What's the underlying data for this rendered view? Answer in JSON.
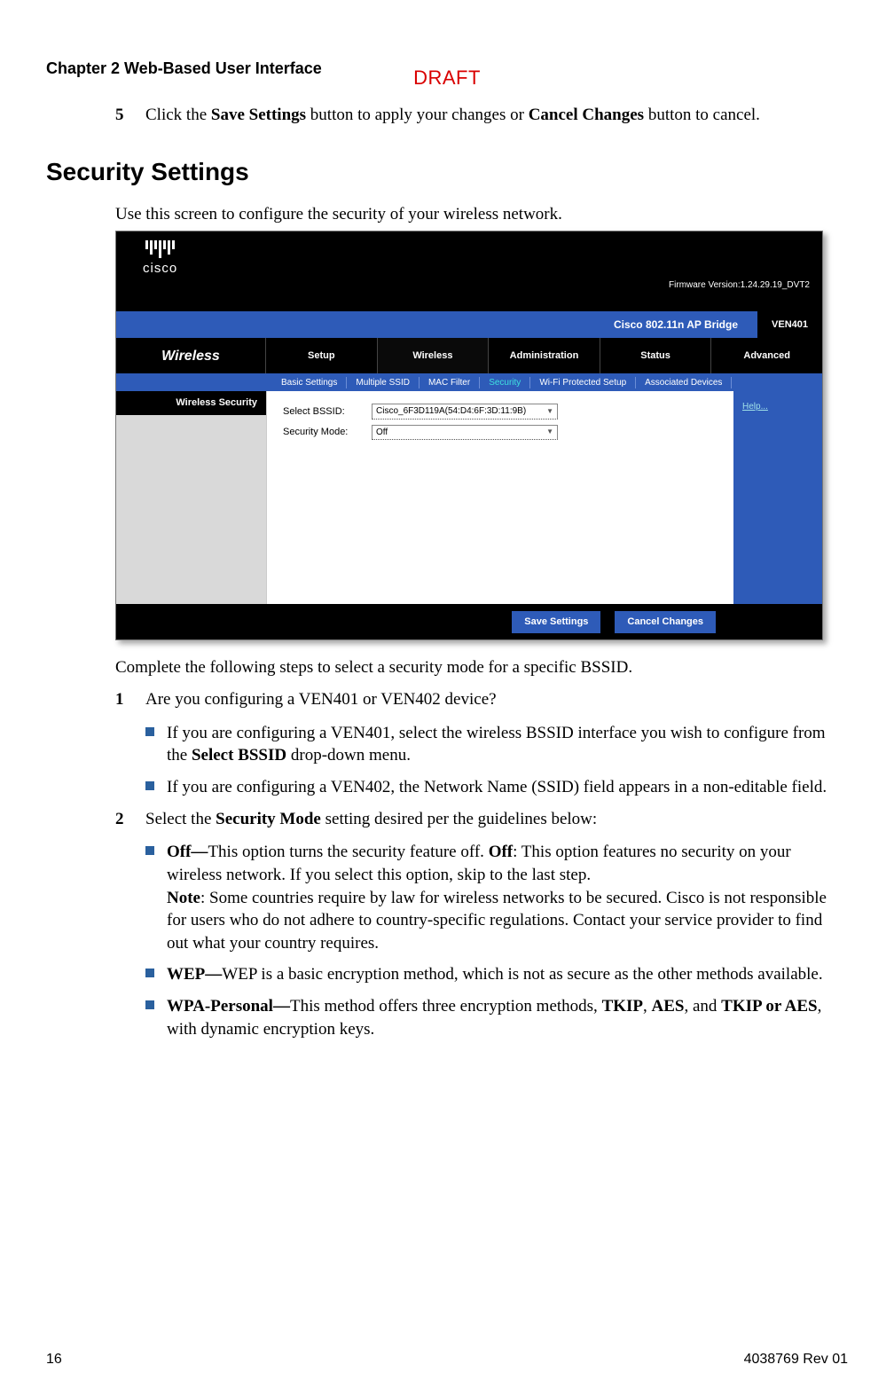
{
  "draft": "DRAFT",
  "chapter": "Chapter 2    Web-Based User Interface",
  "step5_num": "5",
  "step5_a": "Click the ",
  "step5_b": "Save Settings",
  "step5_c": " button to apply your changes or ",
  "step5_d": "Cancel Changes",
  "step5_e": " button to cancel.",
  "section": "Security Settings",
  "intro": "Use this screen to configure the security of your wireless network.",
  "shot": {
    "cisco": "cisco",
    "fw": "Firmware Version:1.24.29.19_DVT2",
    "product": "Cisco 802.11n AP Bridge",
    "model": "VEN401",
    "wireless": "Wireless",
    "tabs": [
      "Setup",
      "Wireless",
      "Administration",
      "Status",
      "Advanced"
    ],
    "subnav": [
      "Basic Settings",
      "Multiple SSID",
      "MAC Filter",
      "Security",
      "Wi-Fi Protected Setup",
      "Associated Devices"
    ],
    "leftHeader": "Wireless Security",
    "lbl_bssid": "Select BSSID:",
    "val_bssid": "Cisco_6F3D119A(54:D4:6F:3D:11:9B)",
    "lbl_mode": "Security Mode:",
    "val_mode": "Off",
    "help": "Help...",
    "btn_save": "Save Settings",
    "btn_cancel": "Cancel Changes"
  },
  "post_intro": "Complete the following steps to select a security mode for a specific BSSID.",
  "s1_num": "1",
  "s1": "Are you configuring a VEN401 or VEN402 device?",
  "s1_b1_a": "If you are configuring a VEN401, select the wireless BSSID interface you wish to configure from the ",
  "s1_b1_b": "Select BSSID",
  "s1_b1_c": " drop-down menu.",
  "s1_b2": "If you are configuring a VEN402, the Network Name (SSID) field appears in a non-editable field.",
  "s2_num": "2",
  "s2_a": "Select the ",
  "s2_b": "Security Mode",
  "s2_c": " setting desired per the guidelines below:",
  "off_a": "Off—",
  "off_b": "This option turns the security feature off. ",
  "off_c": "Off",
  "off_d": ": This option features no security on your wireless network. If you select this option, skip to the last step.",
  "off_note_a": "Note",
  "off_note_b": ": Some countries require by law for wireless networks to be secured. Cisco is not responsible for users who do not adhere to country-specific regulations. Contact your service provider to find out what your country requires.",
  "wep_a": "WEP—",
  "wep_b": "WEP is a basic encryption method, which is not as secure as the other methods available.",
  "wpa_a": "WPA-Personal—",
  "wpa_b": "This method offers three encryption methods, ",
  "wpa_c": "TKIP",
  "wpa_d": ", ",
  "wpa_e": "AES",
  "wpa_f": ", and ",
  "wpa_g": "TKIP or AES",
  "wpa_h": ", with dynamic encryption keys.",
  "footer_left": "16",
  "footer_right": "4038769 Rev 01"
}
